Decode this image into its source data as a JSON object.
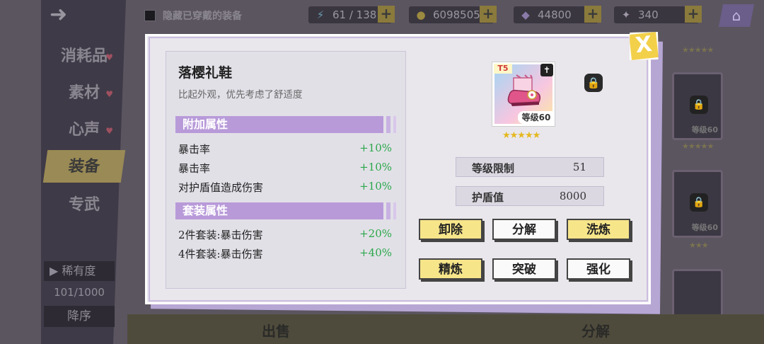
{
  "topbar": {
    "hide_equipped_label": "隐藏已穿戴的装备",
    "stamina": "61 / 138",
    "gold": "6098505",
    "crystals": "44800",
    "tickets": "340",
    "plus": "+"
  },
  "sidebar": {
    "items": [
      {
        "label": "消耗品"
      },
      {
        "label": "素材"
      },
      {
        "label": "心声"
      },
      {
        "label": "装备"
      },
      {
        "label": "专武"
      }
    ],
    "rarity_sort": "稀有度",
    "count": "101/1000",
    "order": "降序"
  },
  "right_list": {
    "level_label": "等级60"
  },
  "bottom_bar": {
    "sell": "出售",
    "decompose": "分解"
  },
  "item": {
    "name": "落樱礼鞋",
    "description": "比起外观，优先考虑了舒适度",
    "tier": "T5",
    "level_badge": "等级60",
    "stars": "★★★★★",
    "level_limit_label": "等级限制",
    "level_limit_value": "51",
    "shield_label": "护盾值",
    "shield_value": "8000"
  },
  "extra_attributes": {
    "title": "附加属性",
    "rows": [
      {
        "name": "暴击率",
        "value": "+10%"
      },
      {
        "name": "暴击率",
        "value": "+10%"
      },
      {
        "name": "对护盾值造成伤害",
        "value": "+10%"
      }
    ]
  },
  "set_attributes": {
    "title": "套装属性",
    "rows": [
      {
        "name": "2件套装:暴击伤害",
        "value": "+20%"
      },
      {
        "name": "4件套装:暴击伤害",
        "value": "+40%"
      }
    ]
  },
  "actions": {
    "unequip": "卸除",
    "decompose": "分解",
    "reforge": "洗炼",
    "refine": "精炼",
    "breakthrough": "突破",
    "enhance": "强化"
  },
  "close_glyph": "X",
  "colors": {
    "accent_purple": "#b89ad9",
    "stat_green": "#2aa84a",
    "button_yellow": "#f7e58a",
    "close_yellow": "#f3d04a"
  }
}
